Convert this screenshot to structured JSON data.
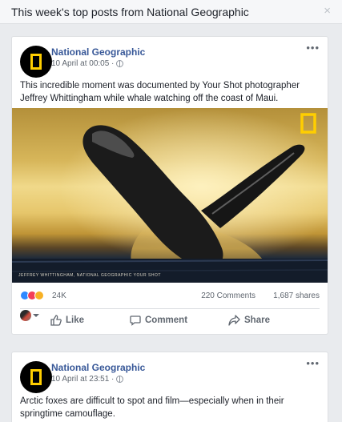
{
  "header": {
    "title": "This week's top posts from National Geographic",
    "close_glyph": "×"
  },
  "posts": [
    {
      "page_name": "National Geographic",
      "timestamp": "10 April at 00:05 ·",
      "text": "This incredible moment was documented by Your Shot photographer Jeffrey Whittingham while whale watching off the coast of Maui.",
      "image_watermark": "JEFFREY WHITTINGHAM, NATIONAL GEOGRAPHIC YOUR SHOT",
      "reaction_count": "24K",
      "reactions": [
        "like",
        "love",
        "wow"
      ],
      "comments": "220 Comments",
      "shares": "1,687 shares",
      "actions": {
        "like": "Like",
        "comment": "Comment",
        "share": "Share"
      }
    },
    {
      "page_name": "National Geographic",
      "timestamp": "10 April at 23:51 ·",
      "text": "Arctic foxes are difficult to spot and film—especially when in their springtime camouflage."
    }
  ],
  "menu_glyph": "•••",
  "colors": {
    "link": "#385898",
    "natgeo_yellow": "#ffce00",
    "background": "#e9ebee"
  },
  "icons": [
    "natgeo-logo",
    "globe-icon",
    "more-icon",
    "like-icon",
    "comment-icon",
    "share-icon",
    "close-icon"
  ]
}
